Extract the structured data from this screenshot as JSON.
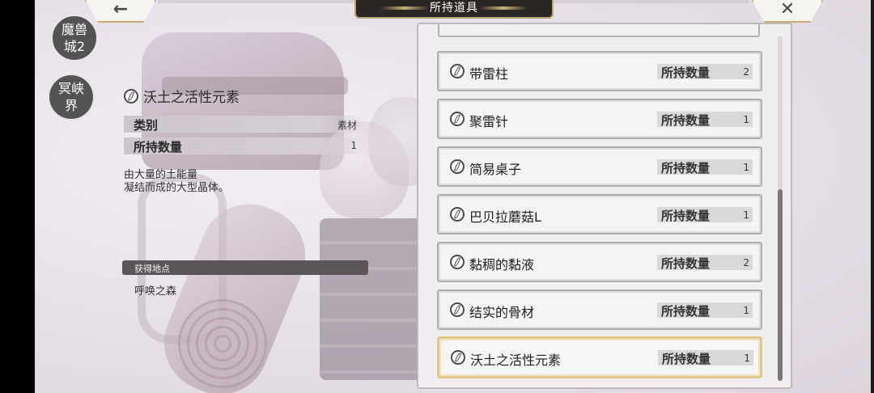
{
  "header": {
    "title": "所持道具",
    "back_icon": "←",
    "close_icon": "✕"
  },
  "locations": [
    {
      "label": "魔兽\n城2"
    },
    {
      "label": "冥峡\n界"
    }
  ],
  "detail": {
    "name": "沃土之活性元素",
    "category_label": "类别",
    "category_value": "素材",
    "qty_label": "所持数量",
    "qty_value": "1",
    "description": "由大量的土能量\n凝结而成的大型晶体。",
    "source_header": "获得地点",
    "source_place": "呼唤之森"
  },
  "list": {
    "qty_label": "所持数量",
    "items": [
      {
        "name": "带雷柱",
        "qty": "2",
        "selected": false
      },
      {
        "name": "聚雷针",
        "qty": "1",
        "selected": false
      },
      {
        "name": "简易桌子",
        "qty": "1",
        "selected": false
      },
      {
        "name": "巴贝拉蘑菇L",
        "qty": "1",
        "selected": false
      },
      {
        "name": "黏稠的黏液",
        "qty": "2",
        "selected": false
      },
      {
        "name": "结实的骨材",
        "qty": "1",
        "selected": false
      },
      {
        "name": "沃土之活性元素",
        "qty": "1",
        "selected": true
      }
    ]
  },
  "colors": {
    "accent_gold": "#e2c78a",
    "location_circle": "#535353",
    "title_bar": "#2a2624"
  }
}
